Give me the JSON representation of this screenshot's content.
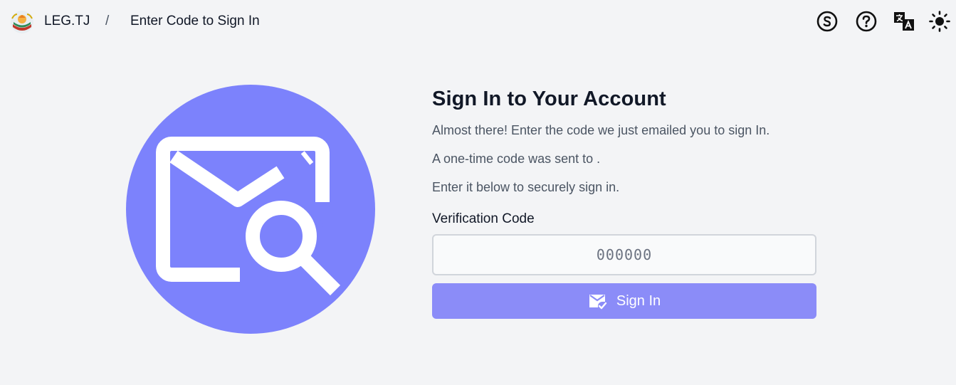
{
  "header": {
    "brand": "LEG.TJ",
    "separator": "/",
    "current_page": "Enter Code to Sign In",
    "icons": [
      "subscription-icon",
      "help-icon",
      "translate-icon",
      "theme-sun-icon"
    ]
  },
  "main": {
    "title": "Sign In to Your Account",
    "line1": "Almost there! Enter the code we just emailed you to sign In.",
    "line2": "A one-time code was sent to .",
    "line3": "Enter it below to securely sign in.",
    "code_label": "Verification Code",
    "code_placeholder": "000000",
    "code_value": "",
    "signin_label": "Sign In"
  },
  "colors": {
    "accent": "#7c82fc",
    "button": "#8b8cf8",
    "background": "#f3f4f6"
  }
}
